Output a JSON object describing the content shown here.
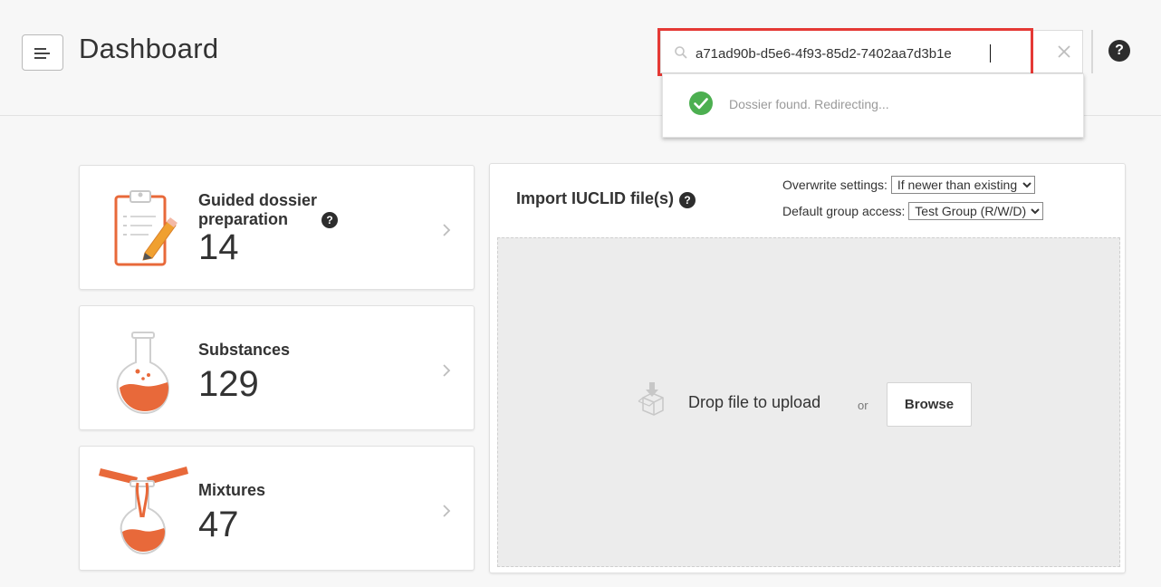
{
  "header": {
    "title": "Dashboard"
  },
  "search": {
    "value": "a71ad90b-d5e6-4f93-85d2-7402aa7d3b1e",
    "result_message": "Dossier found. Redirecting..."
  },
  "help": {
    "label": "?"
  },
  "cards": [
    {
      "title": "Guided dossier preparation",
      "count": "14",
      "icon": "clipboard-icon"
    },
    {
      "title": "Substances",
      "count": "129",
      "icon": "flask-icon"
    },
    {
      "title": "Mixtures",
      "count": "47",
      "icon": "mixing-flask-icon"
    }
  ],
  "import": {
    "title": "Import IUCLID file(s)",
    "overwrite_label": "Overwrite settings:",
    "overwrite_value": "If newer than existing",
    "group_label": "Default group access:",
    "group_value": "Test Group (R/W/D)",
    "drop_label": "Drop file to upload",
    "or_label": "or",
    "browse_label": "Browse"
  },
  "colors": {
    "accent": "#e8693a",
    "success": "#4caf50",
    "highlight": "#e53935"
  }
}
